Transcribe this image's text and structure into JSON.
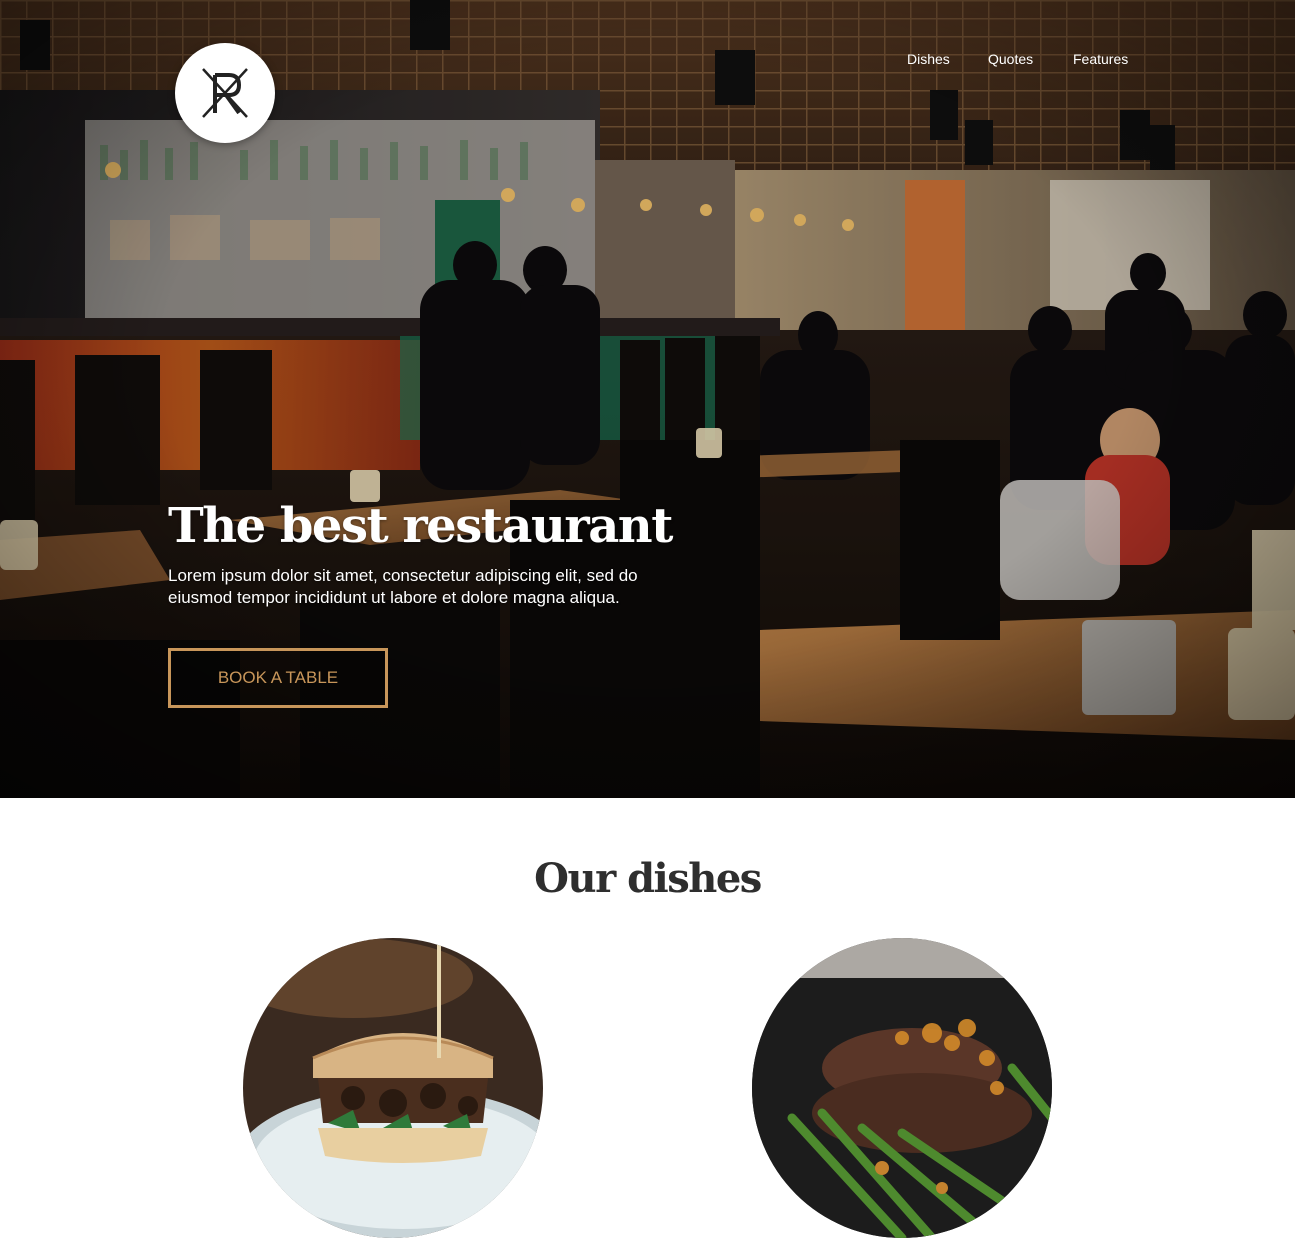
{
  "header": {
    "logo_icon": "restaurant-r-logo-icon",
    "nav": [
      {
        "label": "Dishes"
      },
      {
        "label": "Quotes"
      },
      {
        "label": "Features"
      }
    ]
  },
  "hero": {
    "title": "The best restaurant",
    "text": "Lorem ipsum dolor sit amet, consectetur adipiscing elit, sed do eiusmod tempor incididunt ut labore et dolore magna aliqua.",
    "button_label": "BOOK A TABLE",
    "background_image": "restaurant-interior-photo",
    "accent_color": "#c8965a"
  },
  "dishes": {
    "title": "Our dishes",
    "items": [
      {
        "image": "burger-photo"
      },
      {
        "image": "steak-with-asparagus-photo"
      }
    ]
  }
}
